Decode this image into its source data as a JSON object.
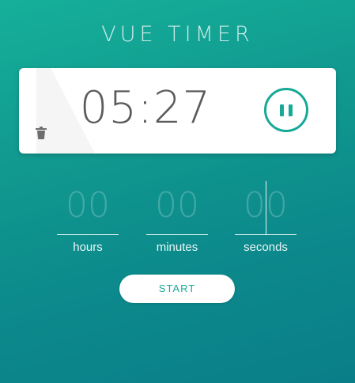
{
  "app": {
    "title": "VUE TIMER"
  },
  "timer": {
    "display": "05:27",
    "state": "running",
    "pause_icon": "pause-icon",
    "delete_icon": "trash-icon"
  },
  "inputs": {
    "hours": {
      "value": "",
      "placeholder": "00",
      "label": "hours"
    },
    "minutes": {
      "value": "",
      "placeholder": "00",
      "label": "minutes"
    },
    "seconds": {
      "value": "",
      "placeholder": "00",
      "label": "seconds"
    }
  },
  "actions": {
    "start_label": "START"
  },
  "colors": {
    "accent": "#16a996",
    "background_top": "#15b09a",
    "background_bottom": "#0a7e88",
    "card": "#ffffff",
    "time_text": "#5c5c5c"
  }
}
